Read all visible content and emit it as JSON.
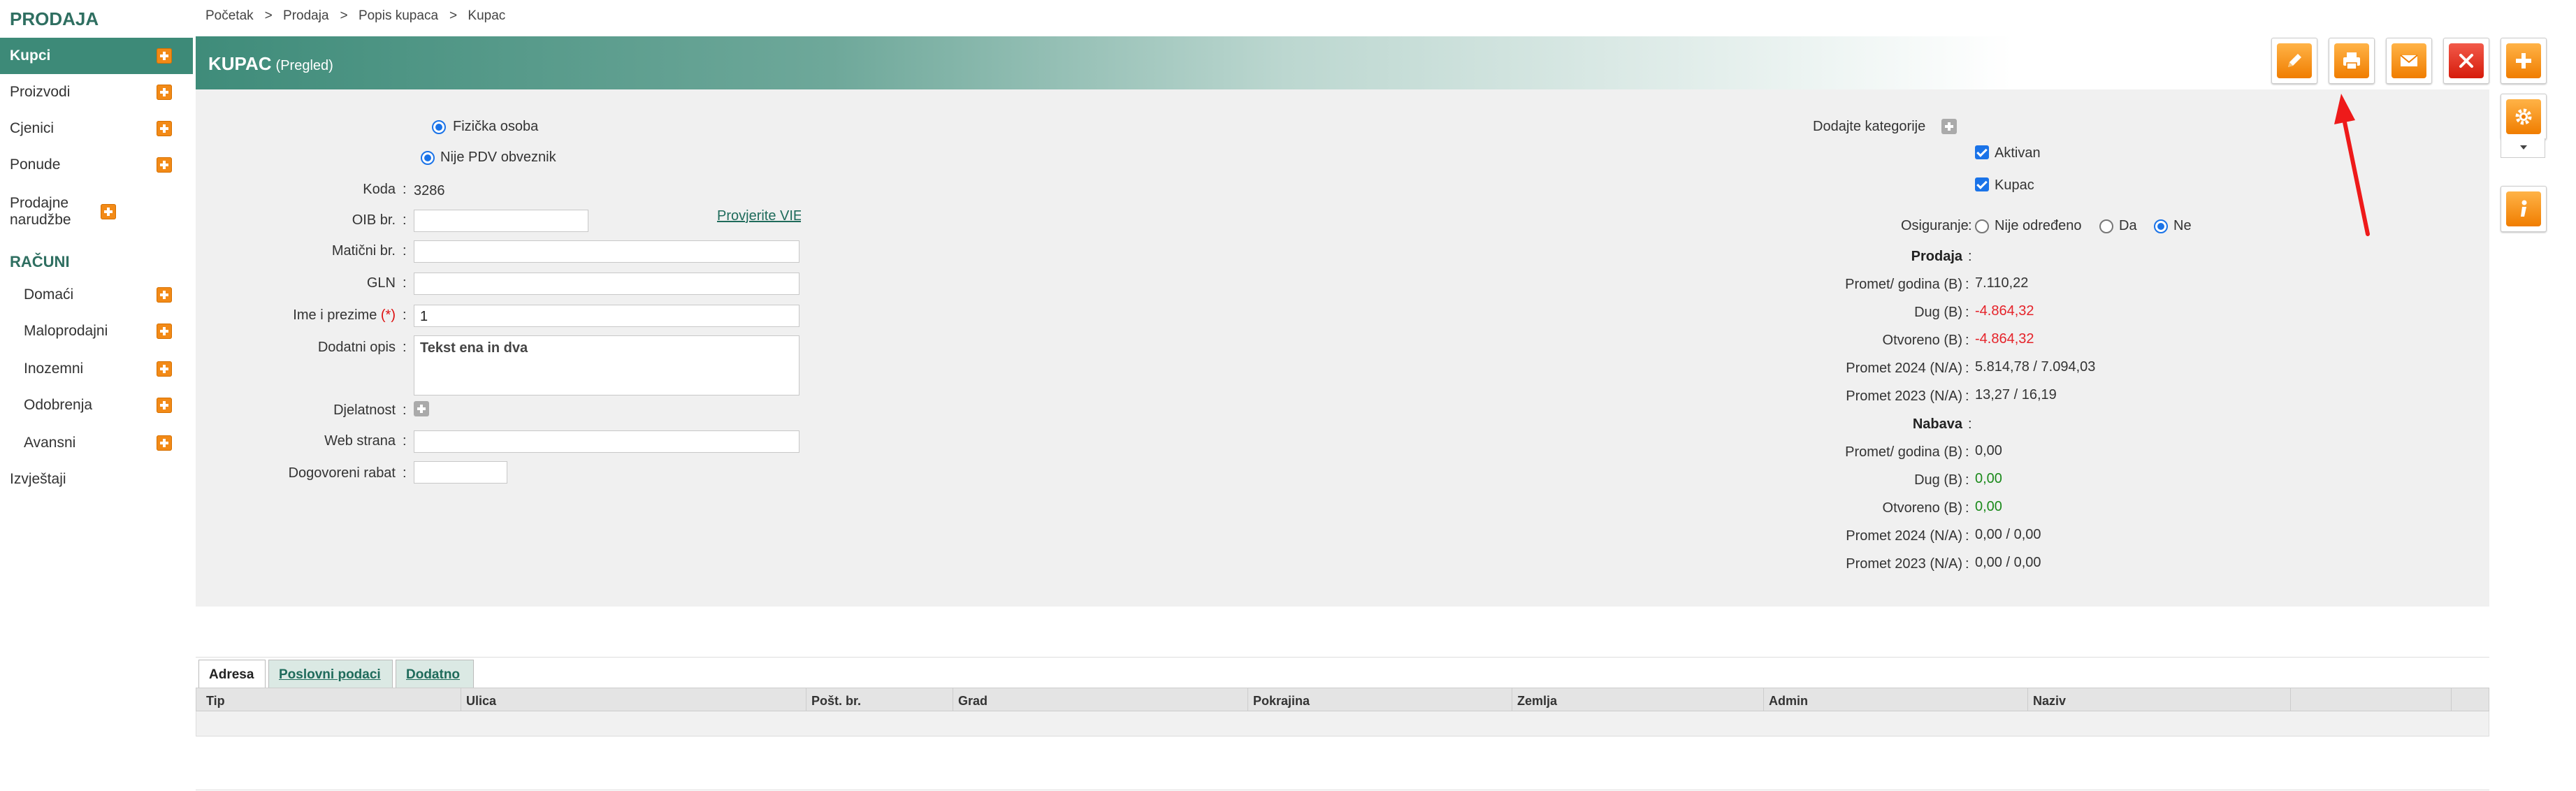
{
  "sidebar": {
    "header": "PRODAJA",
    "items": [
      {
        "label": "Kupci",
        "active": true
      },
      {
        "label": "Proizvodi"
      },
      {
        "label": "Cjenici"
      },
      {
        "label": "Ponude"
      },
      {
        "label": "Prodajne narudžbe"
      }
    ],
    "section": "RAČUNI",
    "sub_items": [
      {
        "label": "Domaći"
      },
      {
        "label": "Maloprodajni"
      },
      {
        "label": "Inozemni"
      },
      {
        "label": "Odobrenja"
      },
      {
        "label": "Avansni"
      }
    ],
    "reports": "Izvještaji"
  },
  "breadcrumb": [
    "Početak",
    "Prodaja",
    "Popis kupaca",
    "Kupac"
  ],
  "breadcrumb_sep": ">",
  "title": {
    "main": "KUPAC",
    "sub": "(Pregled)"
  },
  "toolbar": {
    "buttons": [
      {
        "name": "edit",
        "icon": "pencil-icon"
      },
      {
        "name": "print",
        "icon": "printer-icon"
      },
      {
        "name": "email",
        "icon": "envelope-icon"
      },
      {
        "name": "delete",
        "icon": "close-icon"
      },
      {
        "name": "add",
        "icon": "plus-icon"
      }
    ],
    "side": [
      {
        "icon": "gear-icon"
      },
      {
        "icon": "info-icon"
      }
    ]
  },
  "form": {
    "person_type": "Fizička osoba",
    "vat_status": "Nije PDV obveznik",
    "code_label": "Koda",
    "code_value": "3286",
    "oib_label": "OIB br.",
    "oib_value": "",
    "check_vies": "Provjerite VIES",
    "maticni_label": "Matični br.",
    "maticni_value": "",
    "gln_label": "GLN",
    "gln_value": "",
    "name_label": "Ime i prezime",
    "name_req": "(*)",
    "name_value": "1",
    "desc_label": "Dodatni opis",
    "desc_value": "Tekst ena in dva",
    "activity_label": "Djelatnost",
    "web_label": "Web strana",
    "web_value": "",
    "discount_label": "Dogovoreni rabat",
    "discount_value": ""
  },
  "right": {
    "add_categories": "Dodajte kategorije",
    "cat_active": "Aktivan",
    "cat_customer": "Kupac",
    "insurance_label": "Osiguranje",
    "insurance_options": [
      "Nije određeno",
      "Da",
      "Ne"
    ],
    "insurance_selected": "Ne",
    "sales_head": "Prodaja",
    "sales": [
      {
        "label": "Promet/ godina (B)",
        "value": "7.110,22"
      },
      {
        "label": "Dug (B)",
        "value": "-4.864,32",
        "style": "neg"
      },
      {
        "label": "Otvoreno (B)",
        "value": "-4.864,32",
        "style": "neg"
      },
      {
        "label": "Promet 2024 (N/A)",
        "value": "5.814,78 / 7.094,03"
      },
      {
        "label": "Promet 2023 (N/A)",
        "value": "13,27 / 16,19"
      }
    ],
    "purchase_head": "Nabava",
    "purchase": [
      {
        "label": "Promet/ godina (B)",
        "value": "0,00"
      },
      {
        "label": "Dug (B)",
        "value": "0,00",
        "style": "pos"
      },
      {
        "label": "Otvoreno (B)",
        "value": "0,00",
        "style": "pos"
      },
      {
        "label": "Promet 2024 (N/A)",
        "value": "0,00 / 0,00"
      },
      {
        "label": "Promet 2023 (N/A)",
        "value": "0,00 / 0,00"
      }
    ]
  },
  "tabs": [
    "Adresa",
    "Poslovni podaci",
    "Dodatno"
  ],
  "table": {
    "columns": [
      "Tip",
      "Ulica",
      "Pošt. br.",
      "Grad",
      "Pokrajina",
      "Zemlja",
      "Admin",
      "Naziv"
    ]
  },
  "colors": {
    "accent": "#3d8a78",
    "orange": "#f07d00",
    "red": "#d61b0b",
    "negative": "#e5232a",
    "positive": "#1b8a1b"
  }
}
